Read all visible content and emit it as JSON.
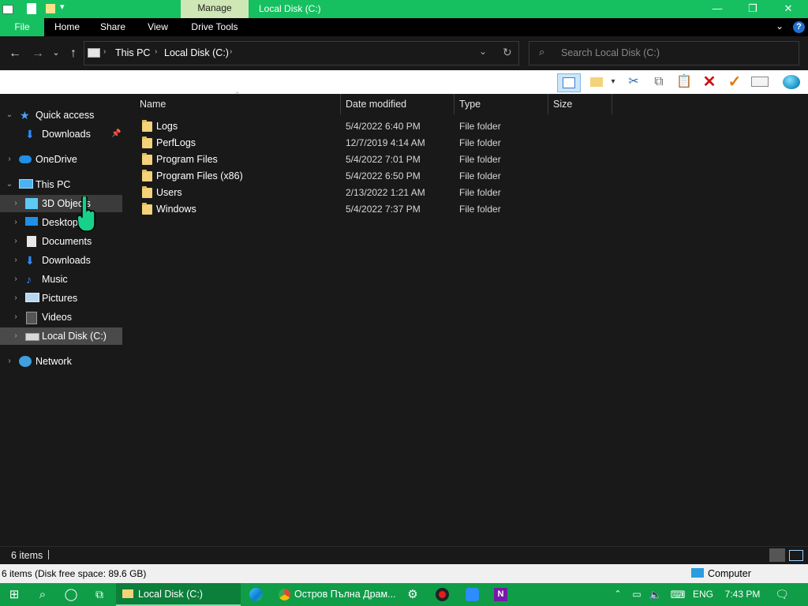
{
  "titlebar": {
    "manage_tab": "Manage",
    "window_title": "Local Disk (C:)",
    "minimize": "—",
    "maximize": "❐",
    "close": "✕"
  },
  "ribbon": {
    "tabs": [
      "File",
      "Home",
      "Share",
      "View",
      "Drive Tools"
    ],
    "collapse_icon": "chevron-down-icon",
    "help_icon": "help-icon"
  },
  "address": {
    "crumbs": [
      "This PC",
      "Local Disk (C:)"
    ],
    "search_placeholder": "Search Local Disk (C:)"
  },
  "toolbar": {
    "icons": [
      "preview-pane-icon",
      "new-folder-icon",
      "cut-icon",
      "copy-icon",
      "paste-icon",
      "delete-icon",
      "check-icon",
      "rename-icon",
      "globe-icon"
    ]
  },
  "nav": {
    "quick_access": "Quick access",
    "qa_downloads": "Downloads",
    "onedrive": "OneDrive",
    "this_pc": "This PC",
    "objects3d": "3D Objects",
    "desktop": "Desktop",
    "documents": "Documents",
    "downloads": "Downloads",
    "music": "Music",
    "pictures": "Pictures",
    "videos": "Videos",
    "local_disk": "Local Disk (C:)",
    "network": "Network"
  },
  "columns": {
    "name": "Name",
    "date": "Date modified",
    "type": "Type",
    "size": "Size"
  },
  "files": [
    {
      "name": "Logs",
      "date": "5/4/2022 6:40 PM",
      "type": "File folder"
    },
    {
      "name": "PerfLogs",
      "date": "12/7/2019 4:14 AM",
      "type": "File folder"
    },
    {
      "name": "Program Files",
      "date": "5/4/2022 7:01 PM",
      "type": "File folder"
    },
    {
      "name": "Program Files (x86)",
      "date": "5/4/2022 6:50 PM",
      "type": "File folder"
    },
    {
      "name": "Users",
      "date": "2/13/2022 1:21 AM",
      "type": "File folder"
    },
    {
      "name": "Windows",
      "date": "5/4/2022 7:37 PM",
      "type": "File folder"
    }
  ],
  "status": {
    "items": "6 items",
    "detail": "6 items (Disk free space: 89.6 GB)",
    "computer": "Computer"
  },
  "taskbar": {
    "explorer_label": "Local Disk (C:)",
    "chrome_label": "Остров Пълна Драм...",
    "lang": "ENG",
    "time": "7:43 PM"
  },
  "colors": {
    "accent": "#16c060",
    "taskbar": "#0f9d48",
    "manage_tab": "#cfe7b4",
    "background": "#191919"
  }
}
